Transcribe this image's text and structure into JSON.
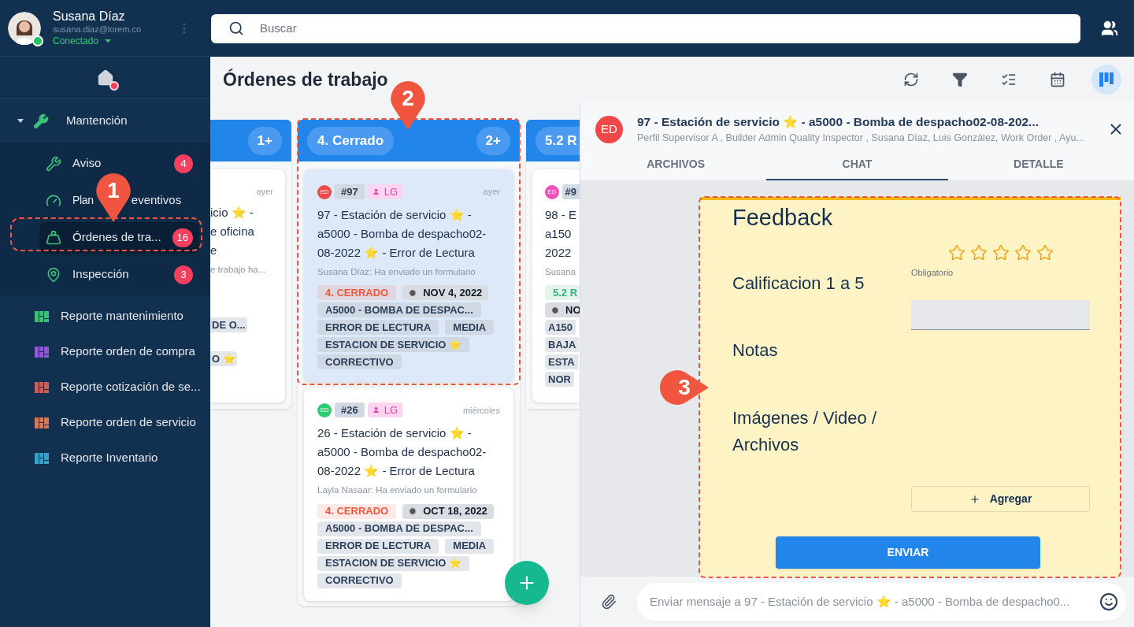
{
  "sidebar": {
    "user": {
      "name": "Susana Díaz",
      "email": "susana.diaz@lorem.co",
      "status": "Conectado",
      "online": true
    },
    "home": {
      "notification": true
    },
    "groups": [
      {
        "label": "Mantención",
        "expanded": true,
        "children": [
          {
            "label": "Aviso",
            "badge": "4",
            "selected": false
          },
          {
            "label": "Plan",
            "label_after": "eventivos",
            "selected": false
          },
          {
            "label": "Órdenes de tra...",
            "badge": "16",
            "selected": true
          },
          {
            "label": "Inspección",
            "badge": "3",
            "selected": false
          }
        ]
      }
    ],
    "reports": [
      {
        "label": "Reporte mantenimiento",
        "color": "#3cbf7a"
      },
      {
        "label": "Reporte orden de compra",
        "color": "#8e5ad6"
      },
      {
        "label": "Reporte cotización de se...",
        "color": "#c95f5f"
      },
      {
        "label": "Reporte orden de servicio",
        "color": "#d47a5c"
      },
      {
        "label": "Reporte Inventario",
        "color": "#3aa0c9"
      }
    ]
  },
  "search": {
    "placeholder": "Buscar"
  },
  "page_title": "Órdenes de trabajo",
  "toolbar": [
    {
      "selected": false
    },
    {
      "selected": false
    },
    {
      "selected": false
    },
    {
      "selected": false
    },
    {
      "selected": true
    }
  ],
  "board": {
    "columns": [
      {
        "kind": "cut_left",
        "count": "1+",
        "cards": [
          {
            "kind": "cut_left",
            "time": "ayer",
            "lines": [
              "icio ⭐ -",
              "e oficina",
              "e"
            ],
            "subtitle": "e trabajo ha...",
            "tags": [
              {
                "kind": "plain",
                "text": "DE O..."
              },
              {
                "kind": "plain",
                "text": "O ⭐"
              }
            ]
          }
        ]
      },
      {
        "kind": "full",
        "title": "4. Cerrado",
        "count": "2+",
        "cards": [
          {
            "kind": "full",
            "selected": true,
            "avatar": "ED",
            "color": "#f04848",
            "number": "#97",
            "assignee": "LG",
            "time": "ayer",
            "title": "97 - Estación de servicio ⭐ - a5000 - Bomba de despacho02-08-2022 ⭐ - Error de Lectura",
            "subtitle": "Susana Díaz: Ha enviado un formulario",
            "tags": [
              {
                "kind": "status",
                "text": "4. CERRADO",
                "color": "#f0573b"
              },
              {
                "kind": "date",
                "text": "NOV 4, 2022"
              },
              {
                "kind": "plain",
                "text": "A5000 - BOMBA DE DESPAC..."
              },
              {
                "kind": "plain",
                "text": "ERROR DE LECTURA"
              },
              {
                "kind": "plain",
                "text": "MEDIA"
              },
              {
                "kind": "plain",
                "text": "ESTACION DE SERVICIO ⭐"
              },
              {
                "kind": "plain",
                "text": "CORRECTIVO"
              }
            ]
          },
          {
            "kind": "full",
            "selected": false,
            "avatar": "ED",
            "color": "#2ecc71",
            "number": "#26",
            "assignee": "LG",
            "time": "miércoles",
            "title": "26 - Estación de servicio ⭐ - a5000 - Bomba de despacho02-08-2022 ⭐ - Error de Lectura",
            "subtitle": "Layla Nasaar: Ha enviado un formulario",
            "tags": [
              {
                "kind": "status",
                "text": "4. CERRADO",
                "color": "#f0573b"
              },
              {
                "kind": "date",
                "text": "OCT 18, 2022"
              },
              {
                "kind": "plain",
                "text": "A5000 - BOMBA DE DESPAC..."
              },
              {
                "kind": "plain",
                "text": "ERROR DE LECTURA"
              },
              {
                "kind": "plain",
                "text": "MEDIA"
              },
              {
                "kind": "plain",
                "text": "ESTACION DE SERVICIO ⭐"
              },
              {
                "kind": "plain",
                "text": "CORRECTIVO"
              }
            ]
          }
        ]
      },
      {
        "kind": "cut_right",
        "title": "5.2 R",
        "cards": [
          {
            "kind": "cut_right",
            "avatar": "ED",
            "color": "#f050b8",
            "number": "#9",
            "lines": [
              "98 - E",
              "a150",
              "2022"
            ],
            "subtitle": "Susana",
            "tags": [
              {
                "kind": "status",
                "text": "5.2 R",
                "color": "#2fb37a"
              },
              {
                "kind": "date",
                "text": "NO"
              },
              {
                "kind": "plain",
                "text": "A150"
              },
              {
                "kind": "plain",
                "text": "BAJA"
              },
              {
                "kind": "plain",
                "text": "ESTA"
              },
              {
                "kind": "plain",
                "text": "NOR"
              }
            ]
          }
        ]
      }
    ]
  },
  "detail": {
    "avatar": "ED",
    "title": "97 - Estación de servicio ⭐ - a5000 - Bomba de despacho02-08-202...",
    "subtitle": "Perfil Supervisor A , Builder Admin Quality Inspector , Susana Díaz, Luis González, Work Order , Ayu...",
    "tabs": [
      {
        "label": "ARCHIVOS",
        "selected": false
      },
      {
        "label": "CHAT",
        "selected": true
      },
      {
        "label": "DETALLE",
        "selected": false
      }
    ],
    "feedback": {
      "title": "Feedback",
      "rating": {
        "label": "Calificacion 1 a 5",
        "stars": 0,
        "hint": "Obligatorio"
      },
      "notes": {
        "label": "Notas"
      },
      "files": {
        "label": "Imágenes / Video / Archivos",
        "button": "Agregar"
      },
      "submit": "ENVIAR"
    },
    "composer": {
      "placeholder": "Enviar mensaje a 97 - Estación de servicio ⭐ - a5000 - Bomba de despacho0..."
    }
  },
  "callouts": [
    "1",
    "2",
    "3"
  ]
}
